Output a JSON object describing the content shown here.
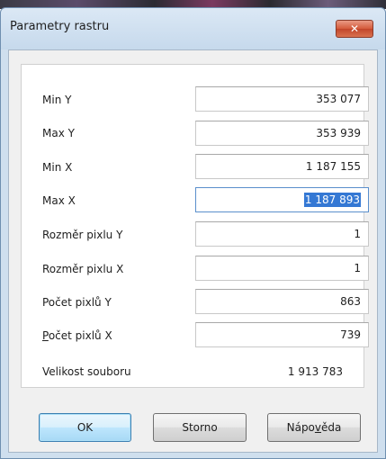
{
  "window": {
    "title": "Parametry rastru",
    "close_glyph": "✕"
  },
  "fields": [
    {
      "label": "Min Y",
      "value": "353 077"
    },
    {
      "label": "Max Y",
      "value": "353 939"
    },
    {
      "label": "Min X",
      "value": "1 187 155"
    },
    {
      "label": "Max X",
      "value": "1 187 893"
    },
    {
      "label": "Rozměr pixlu Y",
      "value": "1"
    },
    {
      "label": "Rozměr pixlu X",
      "value": "1"
    },
    {
      "label": "Počet pixlů Y",
      "value": "863"
    },
    {
      "label_prefix": "P",
      "label_rest": "očet pixlů X",
      "value": "739"
    }
  ],
  "file_size": {
    "label": "Velikost souboru",
    "value": "1 913 783"
  },
  "buttons": {
    "ok": "OK",
    "cancel": "Storno",
    "help_prefix": "Nápo",
    "help_accel": "v",
    "help_rest": "ěda"
  },
  "colors": {
    "selection": "#3478d4",
    "close_button": "#d45a3b",
    "default_button_border": "#3c7fb1"
  }
}
